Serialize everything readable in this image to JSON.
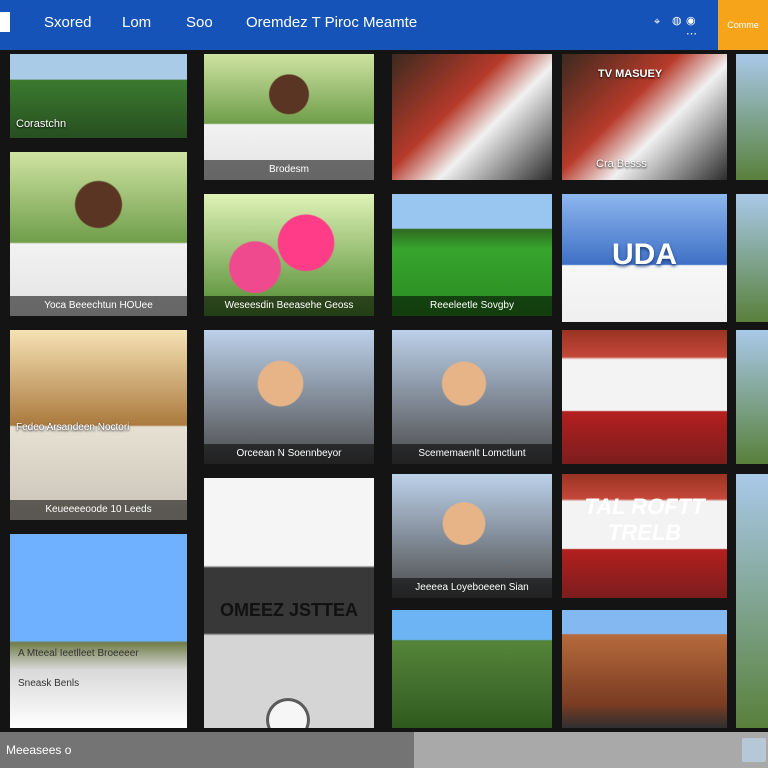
{
  "header": {
    "nav": [
      "Sxored",
      "Lom",
      "Soo",
      "Oremdez T Piroc Meamte"
    ],
    "cta_label": "Comme"
  },
  "tiles": [
    {
      "caption": "Corastchn"
    },
    {
      "caption": "Brodesm"
    },
    {
      "caption": ""
    },
    {
      "caption": "TV MASUEY",
      "sub": "Cra Besss"
    },
    {
      "caption": "Yoca Beeechtun HOUee"
    },
    {
      "caption": "Weseesdin Beeasehe Geoss"
    },
    {
      "caption": "Reeeleetle Sovgby"
    },
    {
      "caption": "UDA"
    },
    {
      "caption": "Fedeo Arsandeen Noctori",
      "sub": "Keueeeeoode 10 Leeds"
    },
    {
      "caption": "Orceean N Soennbeyor"
    },
    {
      "caption": "Scememaenlt Lomctlunt"
    },
    {
      "caption": "TAL ROFTT TRELB"
    },
    {
      "caption": "A Mteeal Ieetlleet Broeeeer",
      "sub": "Sneask Benls"
    },
    {
      "caption": "OMEEZ JSTTEA"
    },
    {
      "caption": "Jeeeea Loyeboeeen Sian"
    },
    {
      "caption": ""
    }
  ],
  "footer": {
    "label": "Meeasees o"
  }
}
